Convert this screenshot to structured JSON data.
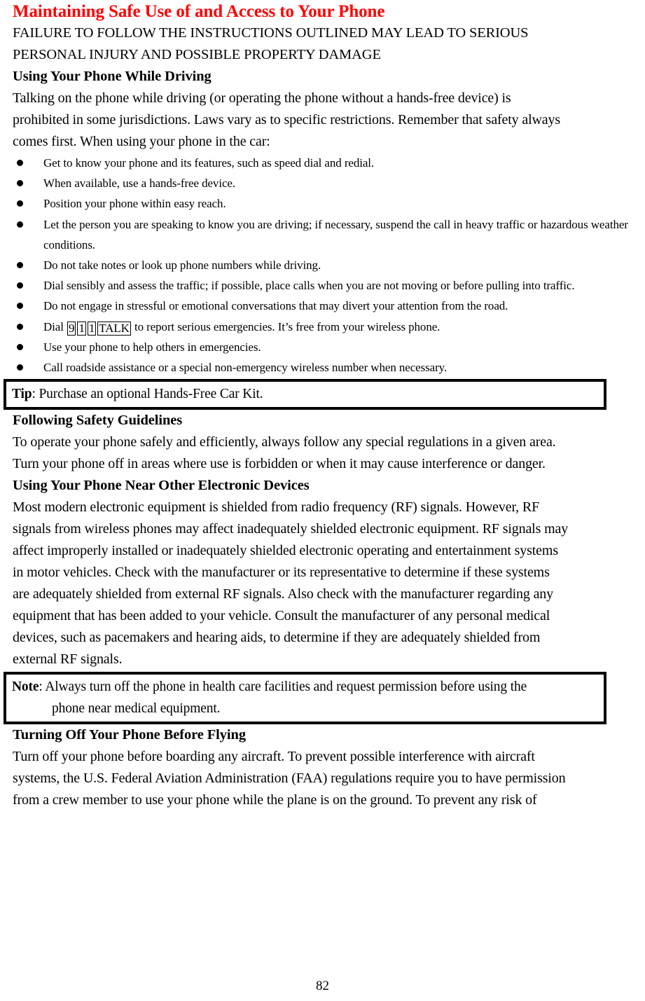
{
  "document": {
    "page_number": "82",
    "accent_color": "#FF0000"
  },
  "headings": {
    "title": "Maintaining Safe Use of and Access to Your Phone",
    "warning_line_1": "FAILURE TO FOLLOW THE INSTRUCTIONS OUTLINED MAY LEAD TO SERIOUS",
    "warning_line_2": "PERSONAL INJURY AND POSSIBLE PROPERTY DAMAGE",
    "using_while_driving": "Using Your Phone While Driving",
    "following_safety_guidelines": "Following Safety Guidelines",
    "near_other_devices": "Using Your Phone Near Other Electronic Devices",
    "turning_off_before_flying": "Turning Off Your Phone Before Flying"
  },
  "driving_intro": {
    "line_1": "Talking on the phone while driving (or operating the phone without a hands-free device) is",
    "line_2": "prohibited in some jurisdictions. Laws vary as to specific restrictions. Remember that safety always",
    "line_3": "comes first. When using your phone in the car:"
  },
  "driving_bullets": [
    {
      "text": "Get to know your phone and its features, such as speed dial and redial."
    },
    {
      "text": "When available, use a hands-free device."
    },
    {
      "text": "Position your phone within easy reach."
    },
    {
      "text": "Let the person you are speaking to know you are driving; if necessary, suspend the call in heavy traffic or hazardous weather conditions."
    },
    {
      "text": "Do not take notes or look up phone numbers while driving."
    },
    {
      "text": "Dial sensibly and assess the traffic; if possible, place calls when you are not moving or before pulling into traffic."
    },
    {
      "text": "Do not engage in stressful or emotional conversations that may divert your attention from the road."
    },
    {
      "text_before": "Dial ",
      "keys": [
        "9",
        "1",
        "1",
        "TALK"
      ],
      "text_after": " to report serious emergencies. It’s free from your wireless phone."
    },
    {
      "text": "Use your phone to help others in emergencies."
    },
    {
      "text": "Call roadside assistance or a special non-emergency wireless number when necessary."
    }
  ],
  "tip_box": {
    "label": "Tip",
    "separator": ": ",
    "text": "Purchase an optional Hands-Free Car Kit."
  },
  "safety_guidelines": {
    "line_1": "To operate your phone safely and efficiently, always follow any special regulations in a given area.",
    "line_2": "Turn your phone off in areas where use is forbidden or when it may cause interference or danger."
  },
  "electronic_devices": {
    "line_1": "Most modern electronic equipment is shielded from radio frequency (RF) signals. However, RF",
    "line_2": "signals from wireless phones may affect inadequately shielded electronic equipment. RF signals may",
    "line_3": "affect improperly installed or inadequately shielded electronic operating and entertainment systems",
    "line_4": "in motor vehicles. Check with the manufacturer or its representative to determine if these systems",
    "line_5": "are adequately shielded from external RF signals. Also check with the manufacturer regarding any",
    "line_6": "equipment that has been added to your vehicle. Consult the manufacturer of any personal medical",
    "line_7": "devices, such as pacemakers and hearing aids, to determine if they are adequately shielded from",
    "line_8": "external RF signals."
  },
  "note_box": {
    "label": "Note",
    "separator": ": ",
    "line_1": "Always turn off the phone in health care facilities and request permission before using the",
    "line_2": "phone near medical equipment."
  },
  "flying": {
    "line_1": "Turn off your phone before boarding any aircraft. To prevent possible interference with aircraft",
    "line_2": "systems, the U.S. Federal Aviation Administration (FAA) regulations require you to have permission",
    "line_3": "from a crew member to use your phone while the plane is on the ground. To prevent any risk of"
  }
}
